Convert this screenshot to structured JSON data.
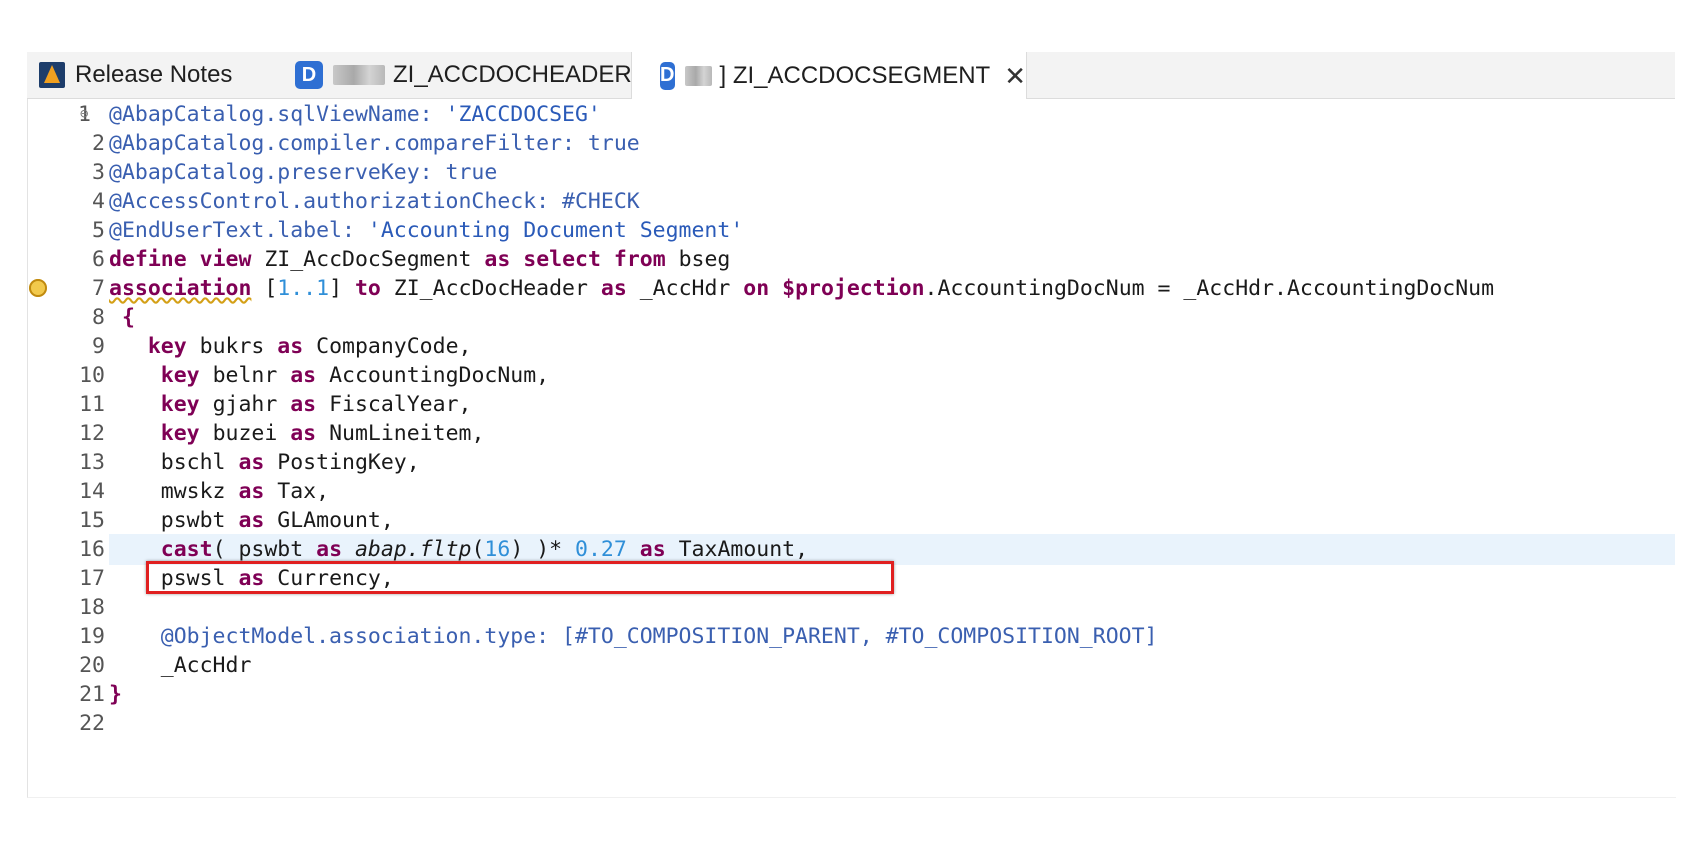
{
  "tabs": [
    {
      "label": "Release Notes",
      "icon": "release-notes-icon",
      "active": false
    },
    {
      "label": "ZI_ACCDOCHEADER",
      "icon": "ddl-d-icon",
      "active": false
    },
    {
      "label": "] ZI_ACCDOCSEGMENT",
      "icon": "ddl-d-icon",
      "active": true,
      "close": "✕"
    }
  ],
  "code": {
    "line_numbers": [
      "1",
      "2",
      "3",
      "4",
      "5",
      "6",
      "7",
      "8",
      "9",
      "10",
      "11",
      "12",
      "13",
      "14",
      "15",
      "16",
      "17",
      "18",
      "19",
      "20",
      "21",
      "22"
    ],
    "l1": [
      "@AbapCatalog.sqlViewName: ",
      "'ZACCDOCSEG'"
    ],
    "l2": [
      "@AbapCatalog.compiler.compareFilter: true"
    ],
    "l3": [
      "@AbapCatalog.preserveKey: true"
    ],
    "l4": [
      "@AccessControl.authorizationCheck: #CHECK"
    ],
    "l5": [
      "@EndUserText.label: ",
      "'Accounting Document Segment'"
    ],
    "l6": [
      "define",
      " ",
      "view",
      " ZI_AccDocSegment ",
      "as",
      " ",
      "select",
      " ",
      "from",
      " bseg"
    ],
    "l7": [
      "association",
      " [",
      "1..1",
      "] ",
      "to",
      " ZI_AccDocHeader ",
      "as",
      " _AccHdr ",
      "on",
      " ",
      "$projection",
      ".AccountingDocNum = _AccHdr.AccountingDocNum"
    ],
    "l8": [
      " {"
    ],
    "l9": [
      "   ",
      "key",
      " bukrs ",
      "as",
      " CompanyCode,"
    ],
    "l10": [
      "    ",
      "key",
      " belnr ",
      "as",
      " AccountingDocNum,"
    ],
    "l11": [
      "    ",
      "key",
      " gjahr ",
      "as",
      " FiscalYear,"
    ],
    "l12": [
      "    ",
      "key",
      " buzei ",
      "as",
      " NumLineitem,"
    ],
    "l13": [
      "    bschl ",
      "as",
      " PostingKey,"
    ],
    "l14": [
      "    mwskz ",
      "as",
      " Tax,"
    ],
    "l15": [
      "    pswbt ",
      "as",
      " GLAmount,"
    ],
    "l16": [
      "    ",
      "cast",
      "( pswbt ",
      "as",
      " ",
      "abap.fltp",
      "(",
      "16",
      ") )* ",
      "0.27",
      " ",
      "as",
      " TaxAmount,"
    ],
    "l17": [
      "    pswsl ",
      "as",
      " Currency,"
    ],
    "l18": [
      ""
    ],
    "l19": [
      "    @ObjectModel.association.type: [#TO_COMPOSITION_PARENT, #TO_COMPOSITION_ROOT]"
    ],
    "l20": [
      "    _AccHdr"
    ],
    "l21": [
      "}"
    ],
    "l22": [
      ""
    ]
  }
}
